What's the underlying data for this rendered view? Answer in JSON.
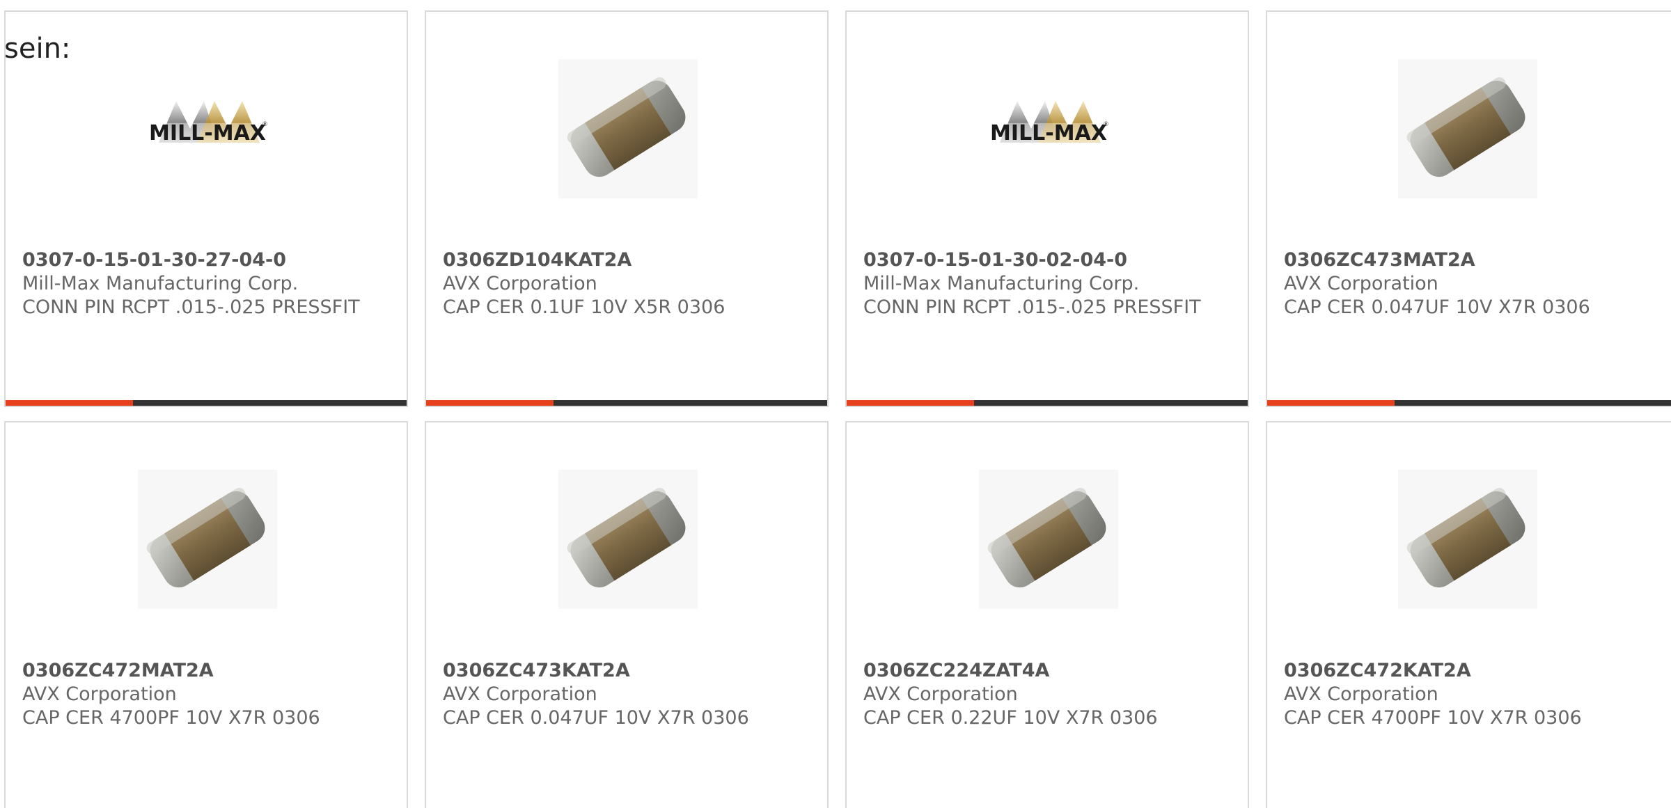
{
  "intro_text": "sein:",
  "colors": {
    "accent": "#e8401c",
    "bar": "#333333",
    "text": "#666666",
    "border": "#d9d9d9"
  },
  "products": [
    {
      "part_number": "0307-0-15-01-30-27-04-0",
      "manufacturer": "Mill-Max Manufacturing Corp.",
      "description": "CONN PIN RCPT .015-.025 PRESSFIT",
      "image": "mill-max-logo"
    },
    {
      "part_number": "0306ZD104KAT2A",
      "manufacturer": "AVX Corporation",
      "description": "CAP CER 0.1UF 10V X5R 0306",
      "image": "ceramic-capacitor-chip"
    },
    {
      "part_number": "0307-0-15-01-30-02-04-0",
      "manufacturer": "Mill-Max Manufacturing Corp.",
      "description": "CONN PIN RCPT .015-.025 PRESSFIT",
      "image": "mill-max-logo"
    },
    {
      "part_number": "0306ZC473MAT2A",
      "manufacturer": "AVX Corporation",
      "description": "CAP CER 0.047UF 10V X7R 0306",
      "image": "ceramic-capacitor-chip"
    },
    {
      "part_number": "0306ZC472MAT2A",
      "manufacturer": "AVX Corporation",
      "description": "CAP CER 4700PF 10V X7R 0306",
      "image": "ceramic-capacitor-chip"
    },
    {
      "part_number": "0306ZC473KAT2A",
      "manufacturer": "AVX Corporation",
      "description": "CAP CER 0.047UF 10V X7R 0306",
      "image": "ceramic-capacitor-chip"
    },
    {
      "part_number": "0306ZC224ZAT4A",
      "manufacturer": "AVX Corporation",
      "description": "CAP CER 0.22UF 10V X7R 0306",
      "image": "ceramic-capacitor-chip"
    },
    {
      "part_number": "0306ZC472KAT2A",
      "manufacturer": "AVX Corporation",
      "description": "CAP CER 4700PF 10V X7R 0306",
      "image": "ceramic-capacitor-chip"
    }
  ]
}
